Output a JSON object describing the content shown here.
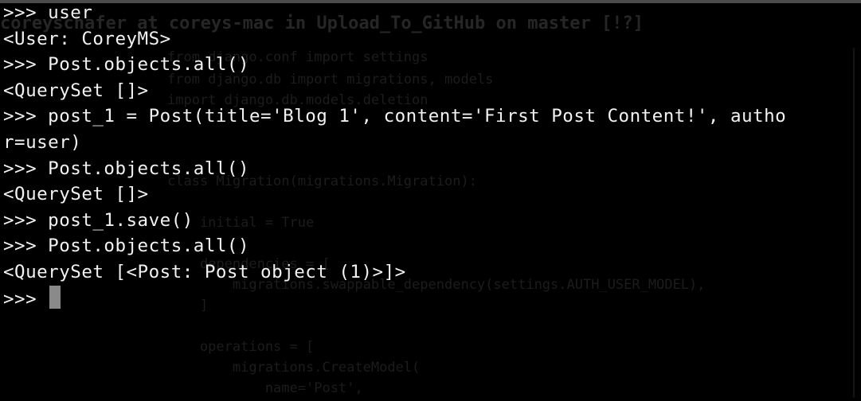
{
  "background_text": {
    "header": "coreyschafer at coreys-mac in Upload_To_GitHub on master [!?]",
    "lines": [
      "from django.conf import settings",
      "from django.db import migrations, models",
      "import django.db.models.deletion",
      "",
      "",
      "class Migration(migrations.Migration):",
      "",
      "    initial = True",
      "",
      "    dependencies = [",
      "        migrations.swappable_dependency(settings.AUTH_USER_MODEL),",
      "    ]",
      "",
      "    operations = [",
      "        migrations.CreateModel(",
      "            name='Post',"
    ]
  },
  "terminal": {
    "lines": [
      ">>> user",
      "<User: CoreyMS>",
      ">>> Post.objects.all()",
      "<QuerySet []>",
      ">>> post_1 = Post(title='Blog 1', content='First Post Content!', autho",
      "r=user)",
      ">>> Post.objects.all()",
      "<QuerySet []>",
      ">>> post_1.save()",
      ">>> Post.objects.all()",
      "<QuerySet [<Post: Post object (1)>]>"
    ],
    "prompt": ">>> "
  }
}
